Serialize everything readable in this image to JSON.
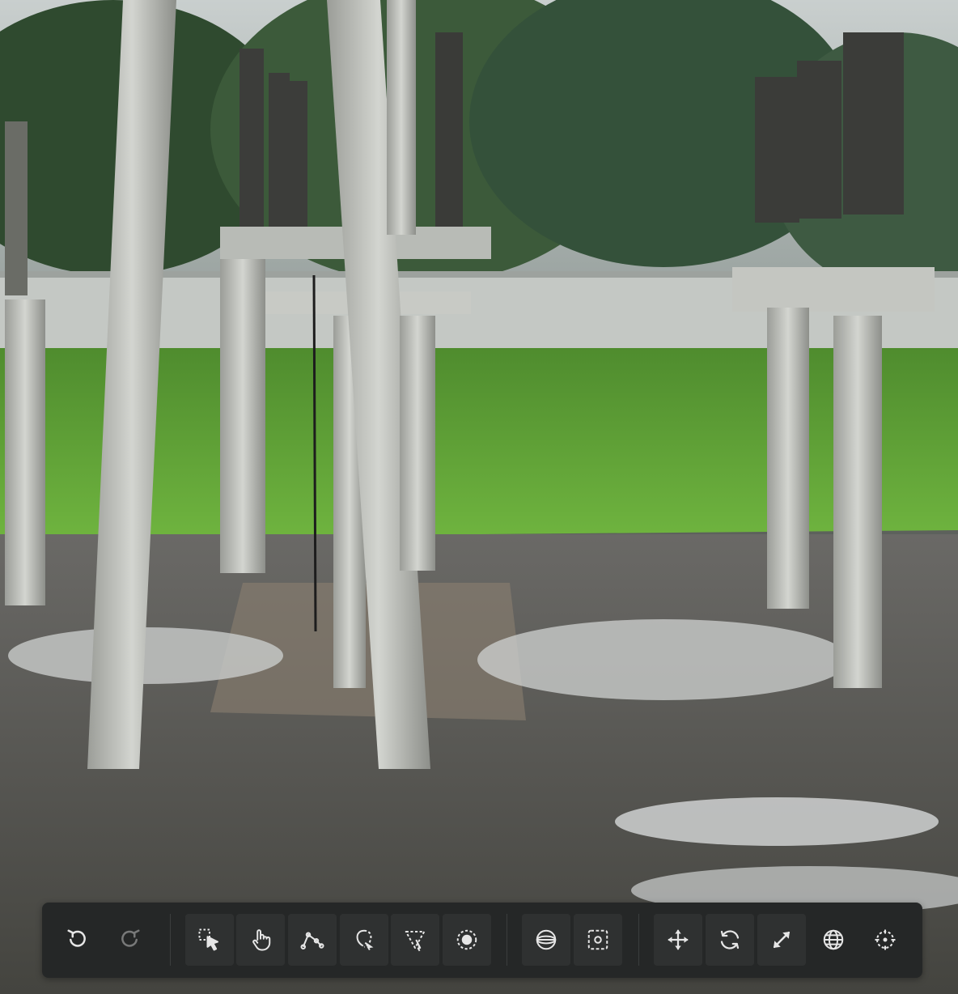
{
  "scene": {
    "description_icon": "photo-substation-scene"
  },
  "toolbar": {
    "groups": [
      {
        "name": "history",
        "tools": [
          {
            "id": "undo",
            "icon": "undo-icon",
            "enabled": true
          },
          {
            "id": "redo",
            "icon": "redo-icon",
            "enabled": false
          }
        ]
      },
      {
        "name": "selection",
        "tools": [
          {
            "id": "select",
            "icon": "select-cursor-icon",
            "active": true
          },
          {
            "id": "pan",
            "icon": "hand-icon"
          },
          {
            "id": "polygon",
            "icon": "polygon-icon"
          },
          {
            "id": "lasso",
            "icon": "lasso-icon"
          },
          {
            "id": "magic-wand",
            "icon": "magic-select-icon"
          },
          {
            "id": "point",
            "icon": "point-select-icon"
          }
        ]
      },
      {
        "name": "view",
        "tools": [
          {
            "id": "horizon",
            "icon": "horizon-icon"
          },
          {
            "id": "focus",
            "icon": "focus-frame-icon"
          }
        ]
      },
      {
        "name": "transform",
        "tools": [
          {
            "id": "move",
            "icon": "move-arrows-icon"
          },
          {
            "id": "rotate",
            "icon": "rotate-icon"
          },
          {
            "id": "scale",
            "icon": "scale-diagonal-icon"
          },
          {
            "id": "globe",
            "icon": "globe-icon"
          },
          {
            "id": "pivot",
            "icon": "pivot-icon"
          }
        ]
      }
    ],
    "colors": {
      "background": "#252727",
      "button": "#2f3131",
      "icon": "#e6e6e6"
    }
  }
}
